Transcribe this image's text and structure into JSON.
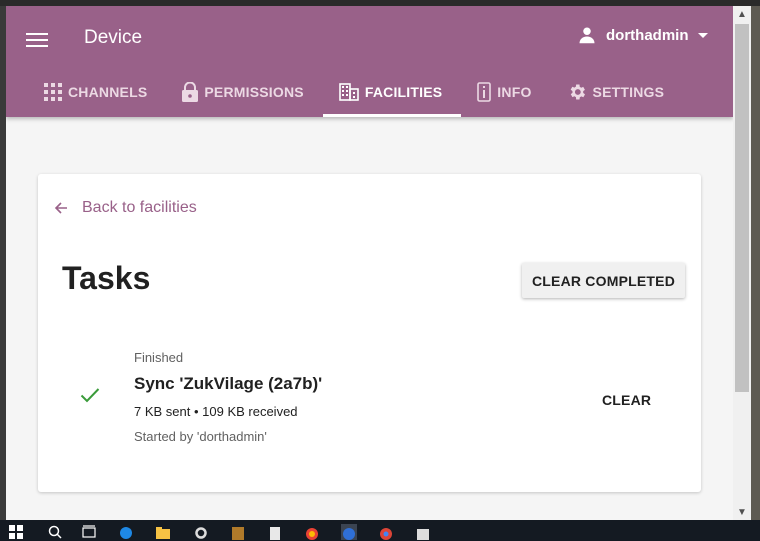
{
  "app": {
    "title": "Device",
    "user": "dorthadmin"
  },
  "tabs": [
    {
      "label": "CHANNELS",
      "icon": "apps-grid-icon",
      "active": false
    },
    {
      "label": "PERMISSIONS",
      "icon": "lock-icon",
      "active": false
    },
    {
      "label": "FACILITIES",
      "icon": "building-icon",
      "active": true
    },
    {
      "label": "INFO",
      "icon": "info-icon",
      "active": false
    },
    {
      "label": "SETTINGS",
      "icon": "gear-icon",
      "active": false
    }
  ],
  "page": {
    "back_label": "Back to facilities",
    "heading": "Tasks",
    "clear_completed_label": "CLEAR COMPLETED"
  },
  "tasks": [
    {
      "status": "Finished",
      "name": "Sync 'ZukVilage (2a7b)'",
      "transfer": "7 KB sent • 109 KB received",
      "started_by": "Started by 'dorthadmin'",
      "clear_label": "CLEAR"
    }
  ],
  "colors": {
    "brand": "#996189",
    "success": "#3a9b3a"
  }
}
